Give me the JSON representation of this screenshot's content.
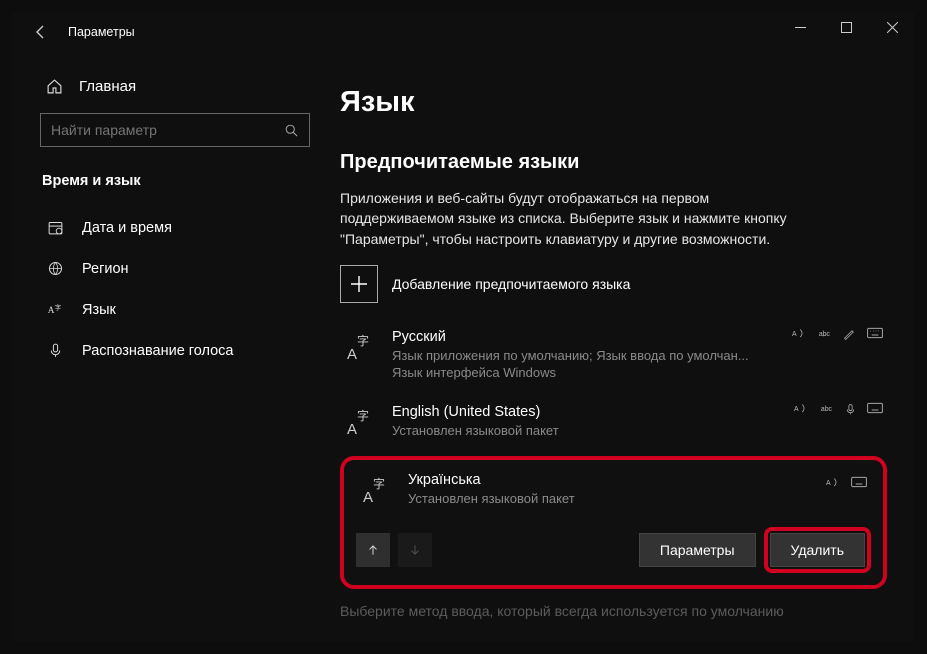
{
  "titlebar": {
    "title": "Параметры"
  },
  "sidebar": {
    "home_label": "Главная",
    "search_placeholder": "Найти параметр",
    "section_title": "Время и язык",
    "items": [
      {
        "label": "Дата и время"
      },
      {
        "label": "Регион"
      },
      {
        "label": "Язык"
      },
      {
        "label": "Распознавание голоса"
      }
    ]
  },
  "main": {
    "title": "Язык",
    "subtitle": "Предпочитаемые языки",
    "description": "Приложения и веб-сайты будут отображаться на первом поддерживаемом языке из списка. Выберите язык и нажмите кнопку \"Параметры\", чтобы настроить клавиатуру и другие возможности.",
    "add_label": "Добавление предпочитаемого языка",
    "languages": [
      {
        "name": "Русский",
        "status": "Язык приложения по умолчанию; Язык ввода по умолчан...\nЯзык интерфейса Windows",
        "badges": [
          "tts",
          "spell",
          "hand",
          "kbd"
        ]
      },
      {
        "name": "English (United States)",
        "status": "Установлен языковой пакет",
        "badges": [
          "tts",
          "spell",
          "mic",
          "kbd"
        ]
      },
      {
        "name": "Українська",
        "status": "Установлен языковой пакет",
        "badges": [
          "tts",
          "kbd"
        ]
      }
    ],
    "actions": {
      "options_label": "Параметры",
      "delete_label": "Удалить"
    },
    "footer_hint": "Выберите метод ввода, который всегда используется по умолчанию"
  }
}
